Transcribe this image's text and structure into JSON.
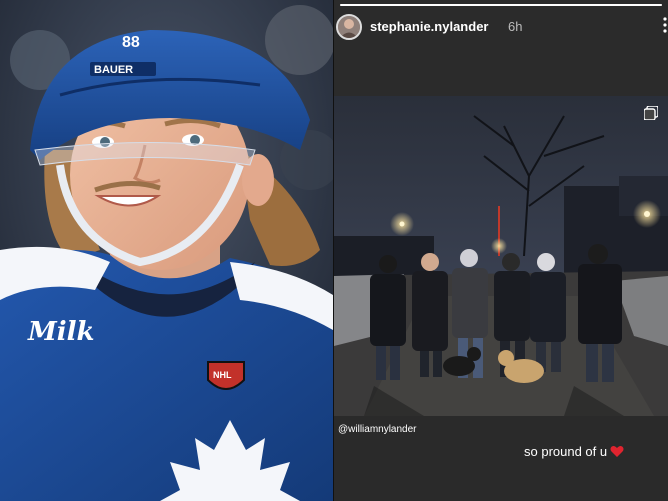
{
  "left_photo": {
    "helmet_number": "88",
    "helmet_brand": "BAUER",
    "jersey_sponsor": "Milk",
    "jersey_badge": "NHL"
  },
  "story": {
    "progress": 1.0,
    "username": "stephanie.nylander",
    "time_ago": "6h",
    "mention": "@williamnylander",
    "caption": "so pround of u",
    "heart_color": "#e0242f"
  },
  "colors": {
    "jersey_blue": "#1b4d9c",
    "helmet_blue": "#1e4f9b",
    "story_bg": "#2b2b2b"
  }
}
